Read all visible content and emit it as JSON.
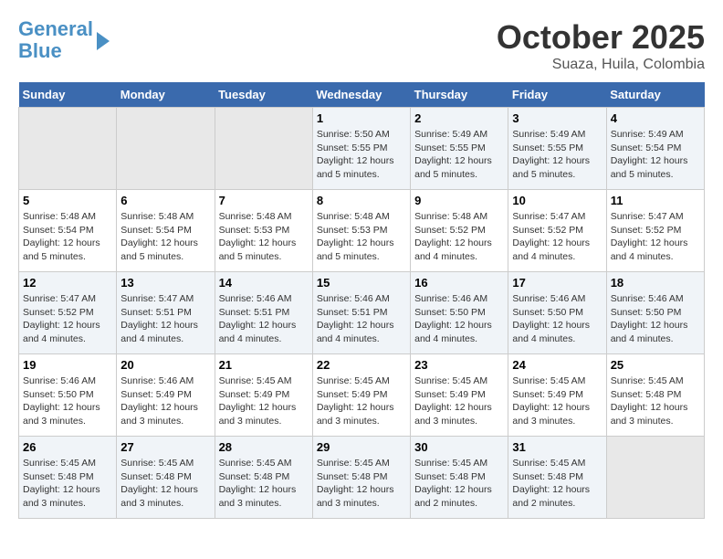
{
  "header": {
    "logo_line1": "General",
    "logo_line2": "Blue",
    "month_title": "October 2025",
    "location": "Suaza, Huila, Colombia"
  },
  "days_of_week": [
    "Sunday",
    "Monday",
    "Tuesday",
    "Wednesday",
    "Thursday",
    "Friday",
    "Saturday"
  ],
  "weeks": [
    [
      {
        "day": "",
        "info": ""
      },
      {
        "day": "",
        "info": ""
      },
      {
        "day": "",
        "info": ""
      },
      {
        "day": "1",
        "info": "Sunrise: 5:50 AM\nSunset: 5:55 PM\nDaylight: 12 hours and 5 minutes."
      },
      {
        "day": "2",
        "info": "Sunrise: 5:49 AM\nSunset: 5:55 PM\nDaylight: 12 hours and 5 minutes."
      },
      {
        "day": "3",
        "info": "Sunrise: 5:49 AM\nSunset: 5:55 PM\nDaylight: 12 hours and 5 minutes."
      },
      {
        "day": "4",
        "info": "Sunrise: 5:49 AM\nSunset: 5:54 PM\nDaylight: 12 hours and 5 minutes."
      }
    ],
    [
      {
        "day": "5",
        "info": "Sunrise: 5:48 AM\nSunset: 5:54 PM\nDaylight: 12 hours and 5 minutes."
      },
      {
        "day": "6",
        "info": "Sunrise: 5:48 AM\nSunset: 5:54 PM\nDaylight: 12 hours and 5 minutes."
      },
      {
        "day": "7",
        "info": "Sunrise: 5:48 AM\nSunset: 5:53 PM\nDaylight: 12 hours and 5 minutes."
      },
      {
        "day": "8",
        "info": "Sunrise: 5:48 AM\nSunset: 5:53 PM\nDaylight: 12 hours and 5 minutes."
      },
      {
        "day": "9",
        "info": "Sunrise: 5:48 AM\nSunset: 5:52 PM\nDaylight: 12 hours and 4 minutes."
      },
      {
        "day": "10",
        "info": "Sunrise: 5:47 AM\nSunset: 5:52 PM\nDaylight: 12 hours and 4 minutes."
      },
      {
        "day": "11",
        "info": "Sunrise: 5:47 AM\nSunset: 5:52 PM\nDaylight: 12 hours and 4 minutes."
      }
    ],
    [
      {
        "day": "12",
        "info": "Sunrise: 5:47 AM\nSunset: 5:52 PM\nDaylight: 12 hours and 4 minutes."
      },
      {
        "day": "13",
        "info": "Sunrise: 5:47 AM\nSunset: 5:51 PM\nDaylight: 12 hours and 4 minutes."
      },
      {
        "day": "14",
        "info": "Sunrise: 5:46 AM\nSunset: 5:51 PM\nDaylight: 12 hours and 4 minutes."
      },
      {
        "day": "15",
        "info": "Sunrise: 5:46 AM\nSunset: 5:51 PM\nDaylight: 12 hours and 4 minutes."
      },
      {
        "day": "16",
        "info": "Sunrise: 5:46 AM\nSunset: 5:50 PM\nDaylight: 12 hours and 4 minutes."
      },
      {
        "day": "17",
        "info": "Sunrise: 5:46 AM\nSunset: 5:50 PM\nDaylight: 12 hours and 4 minutes."
      },
      {
        "day": "18",
        "info": "Sunrise: 5:46 AM\nSunset: 5:50 PM\nDaylight: 12 hours and 4 minutes."
      }
    ],
    [
      {
        "day": "19",
        "info": "Sunrise: 5:46 AM\nSunset: 5:50 PM\nDaylight: 12 hours and 3 minutes."
      },
      {
        "day": "20",
        "info": "Sunrise: 5:46 AM\nSunset: 5:49 PM\nDaylight: 12 hours and 3 minutes."
      },
      {
        "day": "21",
        "info": "Sunrise: 5:45 AM\nSunset: 5:49 PM\nDaylight: 12 hours and 3 minutes."
      },
      {
        "day": "22",
        "info": "Sunrise: 5:45 AM\nSunset: 5:49 PM\nDaylight: 12 hours and 3 minutes."
      },
      {
        "day": "23",
        "info": "Sunrise: 5:45 AM\nSunset: 5:49 PM\nDaylight: 12 hours and 3 minutes."
      },
      {
        "day": "24",
        "info": "Sunrise: 5:45 AM\nSunset: 5:49 PM\nDaylight: 12 hours and 3 minutes."
      },
      {
        "day": "25",
        "info": "Sunrise: 5:45 AM\nSunset: 5:48 PM\nDaylight: 12 hours and 3 minutes."
      }
    ],
    [
      {
        "day": "26",
        "info": "Sunrise: 5:45 AM\nSunset: 5:48 PM\nDaylight: 12 hours and 3 minutes."
      },
      {
        "day": "27",
        "info": "Sunrise: 5:45 AM\nSunset: 5:48 PM\nDaylight: 12 hours and 3 minutes."
      },
      {
        "day": "28",
        "info": "Sunrise: 5:45 AM\nSunset: 5:48 PM\nDaylight: 12 hours and 3 minutes."
      },
      {
        "day": "29",
        "info": "Sunrise: 5:45 AM\nSunset: 5:48 PM\nDaylight: 12 hours and 3 minutes."
      },
      {
        "day": "30",
        "info": "Sunrise: 5:45 AM\nSunset: 5:48 PM\nDaylight: 12 hours and 2 minutes."
      },
      {
        "day": "31",
        "info": "Sunrise: 5:45 AM\nSunset: 5:48 PM\nDaylight: 12 hours and 2 minutes."
      },
      {
        "day": "",
        "info": ""
      }
    ]
  ]
}
